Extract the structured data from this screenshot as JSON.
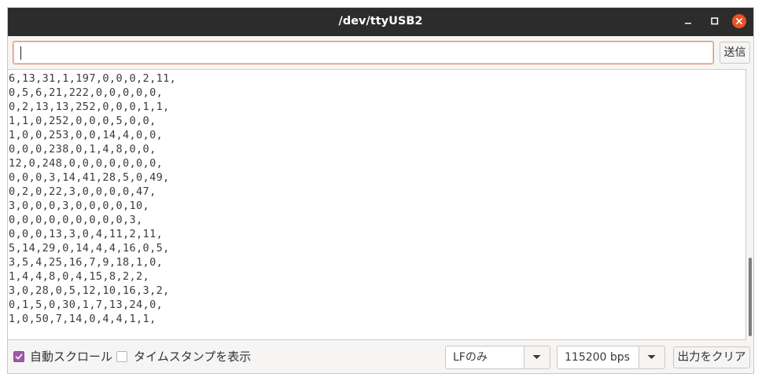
{
  "window": {
    "title": "/dev/ttyUSB2"
  },
  "send": {
    "input_value": "",
    "button_label": "送信"
  },
  "output": {
    "lines": [
      "6,13,31,1,197,0,0,0,2,11,",
      "0,5,6,21,222,0,0,0,0,0,",
      "0,2,13,13,252,0,0,0,1,1,",
      "1,1,0,252,0,0,0,5,0,0,",
      "1,0,0,253,0,0,14,4,0,0,",
      "0,0,0,238,0,1,4,8,0,0,",
      "12,0,248,0,0,0,0,0,0,0,",
      "0,0,0,3,14,41,28,5,0,49,",
      "0,2,0,22,3,0,0,0,0,47,",
      "3,0,0,0,3,0,0,0,0,10,",
      "0,0,0,0,0,0,0,0,0,3,",
      "0,0,0,13,3,0,4,11,2,11,",
      "5,14,29,0,14,4,4,16,0,5,",
      "3,5,4,25,16,7,9,18,1,0,",
      "1,4,4,8,0,4,15,8,2,2,",
      "3,0,28,0,5,12,10,16,3,2,",
      "0,1,5,0,30,1,7,13,24,0,",
      "1,0,50,7,14,0,4,4,1,1,"
    ]
  },
  "bottom": {
    "autoscroll": {
      "label": "自動スクロール",
      "checked": true
    },
    "timestamp": {
      "label": "タイムスタンプを表示",
      "checked": false
    },
    "line_ending": {
      "selected": "LFのみ"
    },
    "baud_rate": {
      "selected": "115200 bps"
    },
    "clear_label": "出力をクリア"
  },
  "colors": {
    "titlebar": "#2c2c2c",
    "close_button": "#e95420",
    "checkbox_accent": "#9e5ba6",
    "input_focus_border": "#e9906f"
  },
  "icons": {
    "minimize": "minimize-icon",
    "maximize": "maximize-icon",
    "close": "close-icon",
    "dropdown": "chevron-down-icon",
    "check": "checkmark-icon"
  }
}
